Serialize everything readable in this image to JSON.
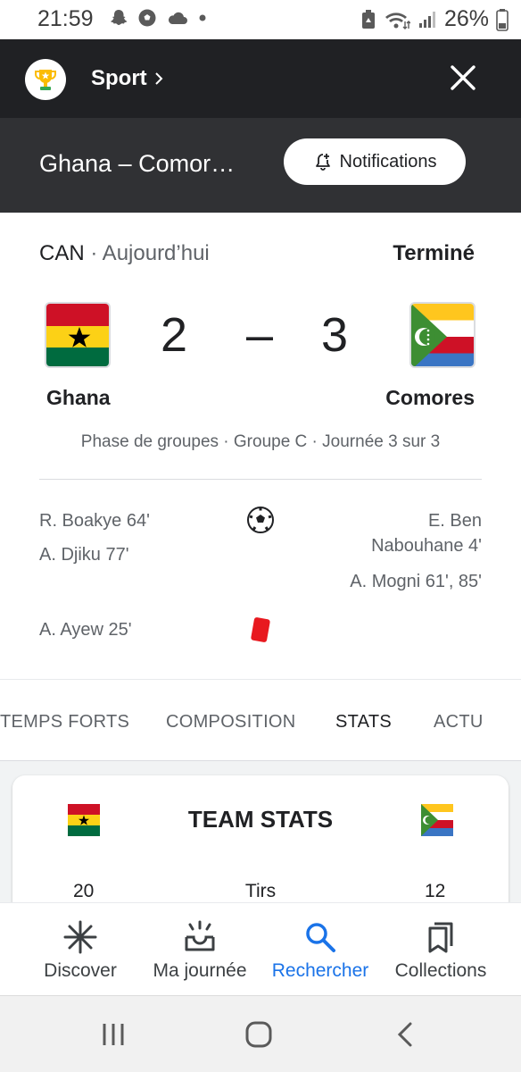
{
  "status_bar": {
    "time": "21:59",
    "battery": "26%",
    "left_icons": [
      "snapchat-icon",
      "soccer-icon",
      "cloud-icon",
      "dot-icon"
    ],
    "right_icons": [
      "recycle-icon",
      "wifi-icon",
      "signal-icon",
      "battery-icon"
    ]
  },
  "header": {
    "section": "Sport",
    "match_title": "Ghana – Comor…",
    "notifications_label": "Notifications"
  },
  "match": {
    "competition": "CAN",
    "date": "· Aujourd’hui",
    "status": "Terminé",
    "home_team": "Ghana",
    "away_team": "Comores",
    "home_score": "2",
    "score_separator": "–",
    "away_score": "3",
    "phase": "Phase de groupes · Groupe C · Journée 3 sur 3",
    "goals_home": [
      "R. Boakye 64'",
      "A. Djiku 77'"
    ],
    "goals_away": [
      "E. Ben",
      "Nabouhane 4'",
      "A. Mogni 61', 85'"
    ],
    "red_cards_home": [
      "A. Ayew 25'"
    ]
  },
  "tabs": [
    {
      "label": "TEMPS FORTS",
      "active": false
    },
    {
      "label": "COMPOSITION",
      "active": false
    },
    {
      "label": "STATS",
      "active": true
    },
    {
      "label": "ACTU",
      "active": false
    }
  ],
  "team_stats": {
    "title": "TEAM STATS",
    "rows": [
      {
        "home": "20",
        "label": "Tirs",
        "away": "12"
      }
    ]
  },
  "bottom_nav": [
    {
      "label": "Discover",
      "icon": "asterisk-icon",
      "active": false
    },
    {
      "label": "Ma journée",
      "icon": "inbox-icon",
      "active": false
    },
    {
      "label": "Rechercher",
      "icon": "search-icon",
      "active": true
    },
    {
      "label": "Collections",
      "icon": "collections-icon",
      "active": false
    }
  ],
  "colors": {
    "header_bg": "#202124",
    "subheader_bg": "#303134",
    "accent": "#1a73e8",
    "red_card": "#e8191f"
  }
}
